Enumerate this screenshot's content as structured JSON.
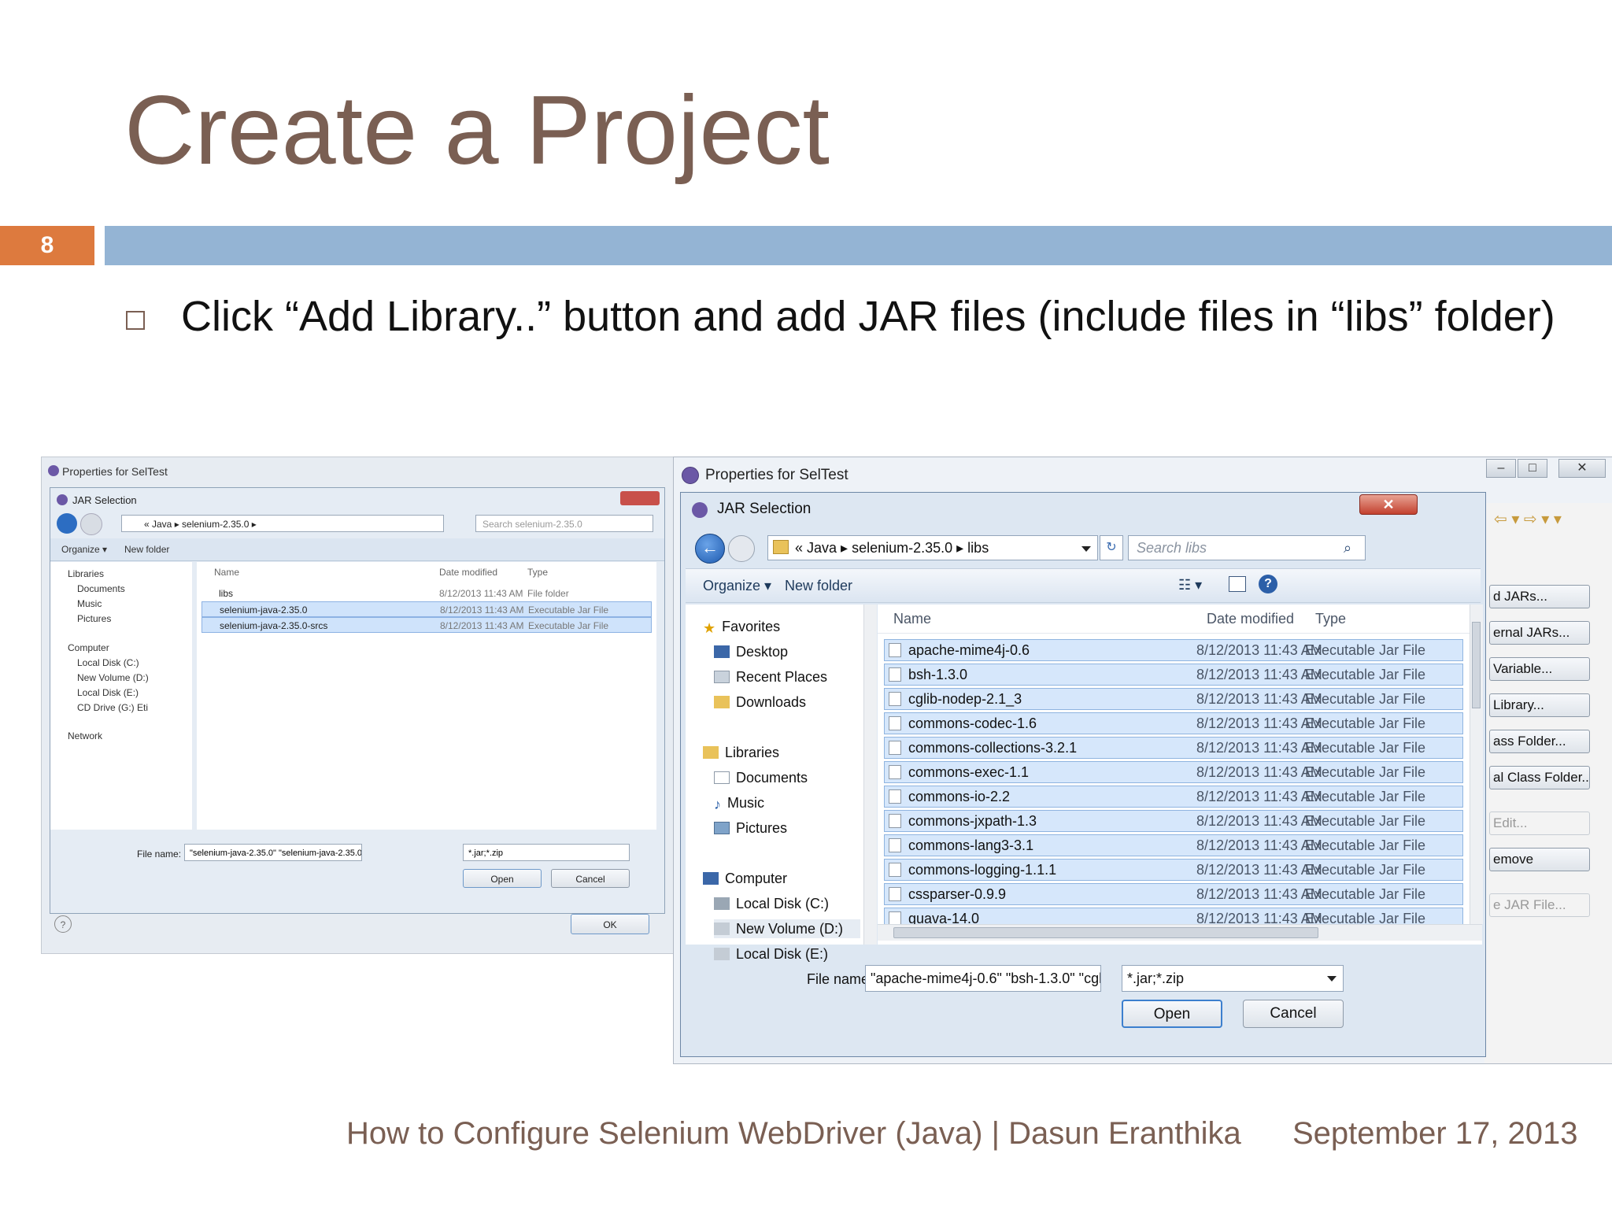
{
  "slide": {
    "title": "Create a Project",
    "number": "8",
    "bullet": "Click “Add Library..” button and add JAR files (include files in “libs” folder)",
    "footer_left": "How to Configure Selenium WebDriver (Java) | Dasun Eranthika",
    "footer_right": "September 17, 2013"
  },
  "colors": {
    "title": "#7a5f53",
    "number_box": "#dd7a3e",
    "bar": "#94b4d4"
  },
  "small_shot": {
    "window_title": "Properties for SelTest",
    "dialog_title": "JAR Selection",
    "address": "« Java ▸ selenium-2.35.0 ▸",
    "search_placeholder": "Search selenium-2.35.0",
    "organize": "Organize ▾",
    "new_folder": "New folder",
    "nav": [
      "Libraries",
      "Documents",
      "Music",
      "Pictures",
      "Computer",
      "Local Disk (C:)",
      "New Volume (D:)",
      "Local Disk (E:)",
      "CD Drive (G:) Eti",
      "Network"
    ],
    "headers": {
      "name": "Name",
      "date": "Date modified",
      "type": "Type"
    },
    "rows": [
      {
        "name": "libs",
        "date": "8/12/2013 11:43 AM",
        "type": "File folder"
      },
      {
        "name": "selenium-java-2.35.0",
        "date": "8/12/2013 11:43 AM",
        "type": "Executable Jar File"
      },
      {
        "name": "selenium-java-2.35.0-srcs",
        "date": "8/12/2013 11:43 AM",
        "type": "Executable Jar File"
      }
    ],
    "file_name_label": "File name:",
    "file_name_value": "\"selenium-java-2.35.0\" \"selenium-java-2.35.0",
    "filter": "*.jar;*.zip",
    "open": "Open",
    "cancel": "Cancel",
    "ok": "OK"
  },
  "big_shot": {
    "window_title": "Properties for SelTest",
    "dialog_title": "JAR Selection",
    "close": "✕",
    "address": "« Java ▸ selenium-2.35.0 ▸ libs",
    "search_placeholder": "Search libs",
    "organize": "Organize ▾",
    "new_folder": "New folder",
    "nav": {
      "favorites": "Favorites",
      "desktop": "Desktop",
      "recent": "Recent Places",
      "downloads": "Downloads",
      "libraries": "Libraries",
      "documents": "Documents",
      "music": "Music",
      "pictures": "Pictures",
      "computer": "Computer",
      "local_c": "Local Disk (C:)",
      "new_d": "New Volume (D:)",
      "local_e": "Local Disk (E:)"
    },
    "headers": {
      "name": "Name",
      "date": "Date modified",
      "type": "Type"
    },
    "rows": [
      {
        "name": "apache-mime4j-0.6",
        "date": "8/12/2013 11:43 AM",
        "type": "Executable Jar File"
      },
      {
        "name": "bsh-1.3.0",
        "date": "8/12/2013 11:43 AM",
        "type": "Executable Jar File"
      },
      {
        "name": "cglib-nodep-2.1_3",
        "date": "8/12/2013 11:43 AM",
        "type": "Executable Jar File"
      },
      {
        "name": "commons-codec-1.6",
        "date": "8/12/2013 11:43 AM",
        "type": "Executable Jar File"
      },
      {
        "name": "commons-collections-3.2.1",
        "date": "8/12/2013 11:43 AM",
        "type": "Executable Jar File"
      },
      {
        "name": "commons-exec-1.1",
        "date": "8/12/2013 11:43 AM",
        "type": "Executable Jar File"
      },
      {
        "name": "commons-io-2.2",
        "date": "8/12/2013 11:43 AM",
        "type": "Executable Jar File"
      },
      {
        "name": "commons-jxpath-1.3",
        "date": "8/12/2013 11:43 AM",
        "type": "Executable Jar File"
      },
      {
        "name": "commons-lang3-3.1",
        "date": "8/12/2013 11:43 AM",
        "type": "Executable Jar File"
      },
      {
        "name": "commons-logging-1.1.1",
        "date": "8/12/2013 11:43 AM",
        "type": "Executable Jar File"
      },
      {
        "name": "cssparser-0.9.9",
        "date": "8/12/2013 11:43 AM",
        "type": "Executable Jar File"
      },
      {
        "name": "guava-14.0",
        "date": "8/12/2013 11:43 AM",
        "type": "Executable Jar File"
      }
    ],
    "file_name_label": "File name:",
    "file_name_value": "\"apache-mime4j-0.6\" \"bsh-1.3.0\" \"cglib-nodep",
    "filter": "*.jar;*.zip",
    "open": "Open",
    "cancel": "Cancel",
    "side_buttons": [
      "d JARs...",
      "ernal JARs...",
      "Variable...",
      "Library...",
      "ass Folder...",
      "al Class Folder...",
      "Edit...",
      "emove",
      "e JAR File..."
    ]
  }
}
